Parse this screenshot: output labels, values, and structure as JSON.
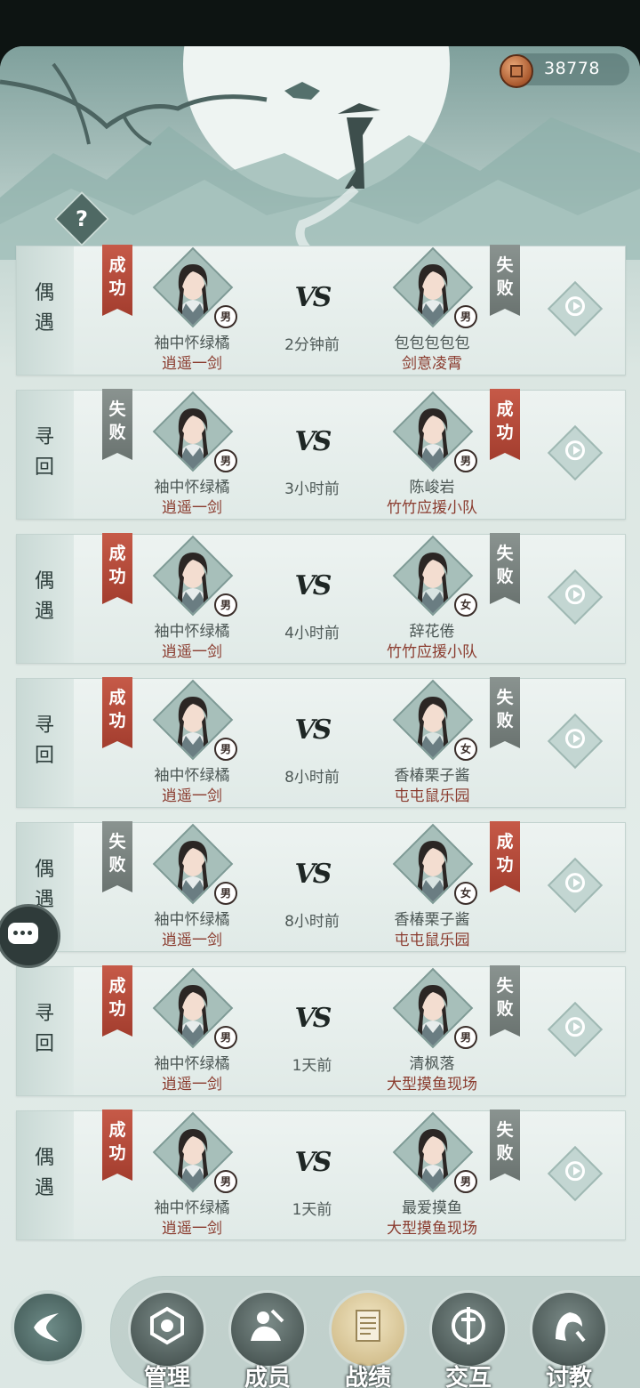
{
  "currency": {
    "icon": "copper-coin-icon",
    "value": "38778"
  },
  "help": {
    "label": "?"
  },
  "vs_label": "VS",
  "records": [
    {
      "mode": "偶遇",
      "left": {
        "result": "成功",
        "name": "袖中怀绿橘",
        "team": "逍遥一剑",
        "gender": "男"
      },
      "time": "2分钟前",
      "right": {
        "result": "失败",
        "name": "包包包包包",
        "team": "剑意凌霄",
        "gender": "男"
      }
    },
    {
      "mode": "寻回",
      "left": {
        "result": "失败",
        "name": "袖中怀绿橘",
        "team": "逍遥一剑",
        "gender": "男"
      },
      "time": "3小时前",
      "right": {
        "result": "成功",
        "name": "陈峻岩",
        "team": "竹竹应援小队",
        "gender": "男"
      }
    },
    {
      "mode": "偶遇",
      "left": {
        "result": "成功",
        "name": "袖中怀绿橘",
        "team": "逍遥一剑",
        "gender": "男"
      },
      "time": "4小时前",
      "right": {
        "result": "失败",
        "name": "辞花倦",
        "team": "竹竹应援小队",
        "gender": "女"
      }
    },
    {
      "mode": "寻回",
      "left": {
        "result": "成功",
        "name": "袖中怀绿橘",
        "team": "逍遥一剑",
        "gender": "男"
      },
      "time": "8小时前",
      "right": {
        "result": "失败",
        "name": "香椿栗子酱",
        "team": "屯屯鼠乐园",
        "gender": "女"
      }
    },
    {
      "mode": "偶遇",
      "left": {
        "result": "失败",
        "name": "袖中怀绿橘",
        "team": "逍遥一剑",
        "gender": "男"
      },
      "time": "8小时前",
      "right": {
        "result": "成功",
        "name": "香椿栗子酱",
        "team": "屯屯鼠乐园",
        "gender": "女"
      }
    },
    {
      "mode": "寻回",
      "left": {
        "result": "成功",
        "name": "袖中怀绿橘",
        "team": "逍遥一剑",
        "gender": "男"
      },
      "time": "1天前",
      "right": {
        "result": "失败",
        "name": "清枫落",
        "team": "大型摸鱼现场",
        "gender": "男"
      }
    },
    {
      "mode": "偶遇",
      "left": {
        "result": "成功",
        "name": "袖中怀绿橘",
        "team": "逍遥一剑",
        "gender": "男"
      },
      "time": "1天前",
      "right": {
        "result": "失败",
        "name": "最爱摸鱼",
        "team": "大型摸鱼现场",
        "gender": "男"
      }
    }
  ],
  "colors": {
    "win": "#b34a3a",
    "lose": "#7a8380",
    "team_text": "#8a3b2e"
  },
  "tabs": [
    {
      "label": "管理",
      "icon": "management-icon",
      "active": false
    },
    {
      "label": "成员",
      "icon": "members-icon",
      "active": false
    },
    {
      "label": "战绩",
      "icon": "scroll-record-icon",
      "active": true
    },
    {
      "label": "交互",
      "icon": "interaction-icon",
      "active": false
    },
    {
      "label": "讨教",
      "icon": "challenge-icon",
      "active": false
    }
  ]
}
